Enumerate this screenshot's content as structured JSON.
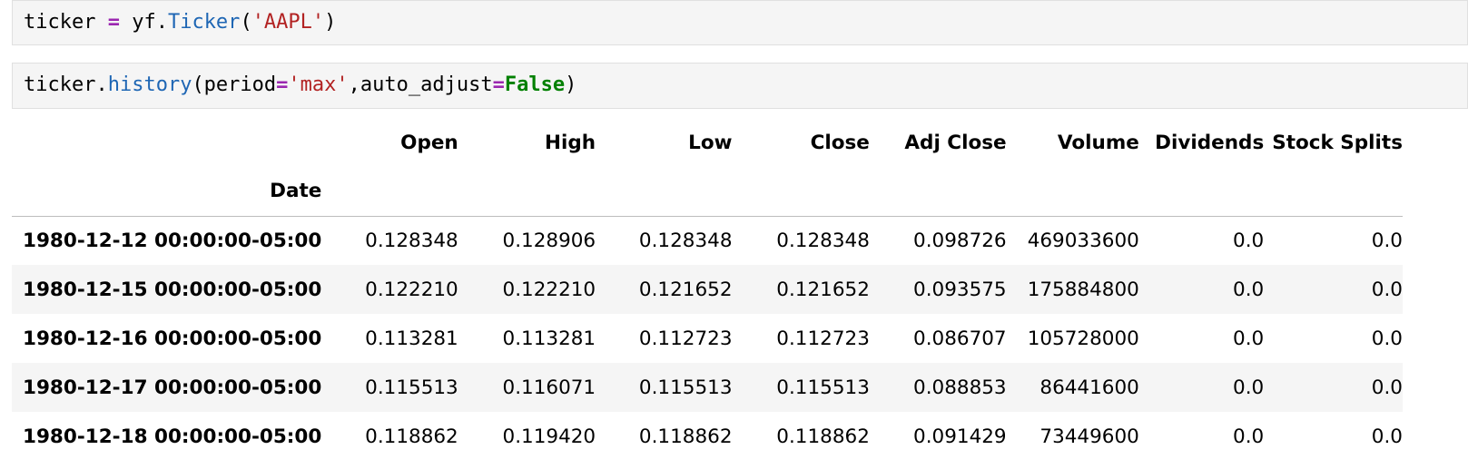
{
  "cells": [
    {
      "tokens": [
        {
          "t": "ticker ",
          "c": "tok-name"
        },
        {
          "t": "=",
          "c": "tok-op"
        },
        {
          "t": " yf.",
          "c": "tok-name"
        },
        {
          "t": "Ticker",
          "c": "tok-func"
        },
        {
          "t": "(",
          "c": "tok-p"
        },
        {
          "t": "'AAPL'",
          "c": "tok-str"
        },
        {
          "t": ")",
          "c": "tok-p"
        }
      ]
    },
    {
      "tokens": [
        {
          "t": "ticker.",
          "c": "tok-name"
        },
        {
          "t": "history",
          "c": "tok-func"
        },
        {
          "t": "(period",
          "c": "tok-p"
        },
        {
          "t": "=",
          "c": "tok-op"
        },
        {
          "t": "'max'",
          "c": "tok-str"
        },
        {
          "t": ",auto_adjust",
          "c": "tok-p"
        },
        {
          "t": "=",
          "c": "tok-op"
        },
        {
          "t": "False",
          "c": "tok-kw"
        },
        {
          "t": ")",
          "c": "tok-p"
        }
      ]
    }
  ],
  "table": {
    "columns": [
      "Open",
      "High",
      "Low",
      "Close",
      "Adj Close",
      "Volume",
      "Dividends",
      "Stock Splits"
    ],
    "index_name": "Date",
    "rows": [
      {
        "date": "1980-12-12 00:00:00-05:00",
        "values": [
          "0.128348",
          "0.128906",
          "0.128348",
          "0.128348",
          "0.098726",
          "469033600",
          "0.0",
          "0.0"
        ]
      },
      {
        "date": "1980-12-15 00:00:00-05:00",
        "values": [
          "0.122210",
          "0.122210",
          "0.121652",
          "0.121652",
          "0.093575",
          "175884800",
          "0.0",
          "0.0"
        ]
      },
      {
        "date": "1980-12-16 00:00:00-05:00",
        "values": [
          "0.113281",
          "0.113281",
          "0.112723",
          "0.112723",
          "0.086707",
          "105728000",
          "0.0",
          "0.0"
        ]
      },
      {
        "date": "1980-12-17 00:00:00-05:00",
        "values": [
          "0.115513",
          "0.116071",
          "0.115513",
          "0.115513",
          "0.088853",
          "86441600",
          "0.0",
          "0.0"
        ]
      },
      {
        "date": "1980-12-18 00:00:00-05:00",
        "values": [
          "0.118862",
          "0.119420",
          "0.118862",
          "0.118862",
          "0.091429",
          "73449600",
          "0.0",
          "0.0"
        ]
      }
    ]
  }
}
